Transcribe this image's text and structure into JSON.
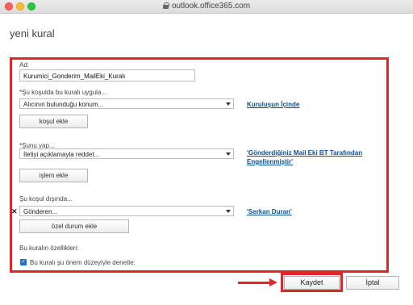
{
  "browser": {
    "url": "outlook.office365.com"
  },
  "page": {
    "title": "yeni kural"
  },
  "form": {
    "name_label": "Ad:",
    "name_value": "Kurumici_Gonderim_MailEki_Kuralı",
    "condition_label": "*Şu koşulda bu kuralı uygula...",
    "condition_select": "Alıcının bulunduğu konum...",
    "condition_link": "Kuruluşun İçinde",
    "add_condition_button": "koşul ekle",
    "action_label": "*Şunu yap...",
    "action_select": "İletiyi açıklamayla reddet...",
    "action_link": "'Gönderdiğiniz Mail Eki BT Tarafından Engellenmiştir'",
    "add_action_button": "işlem ekle",
    "exception_label": "Şu koşul dışında...",
    "exception_select": "Gönderen...",
    "exception_link": "'Serkan Duran'",
    "add_exception_button": "özel durum ekle",
    "properties_label": "Bu kuralın özellikleri:",
    "severity_checkbox_label": "Bu kuralı şu önem düzeyiyle denetle:",
    "severity_checked": true
  },
  "footer": {
    "save_button": "Kaydet",
    "cancel_button": "İptal"
  },
  "colors": {
    "highlight": "#e0262b",
    "link": "#0b4f9c",
    "checkbox": "#1f6fd1"
  }
}
